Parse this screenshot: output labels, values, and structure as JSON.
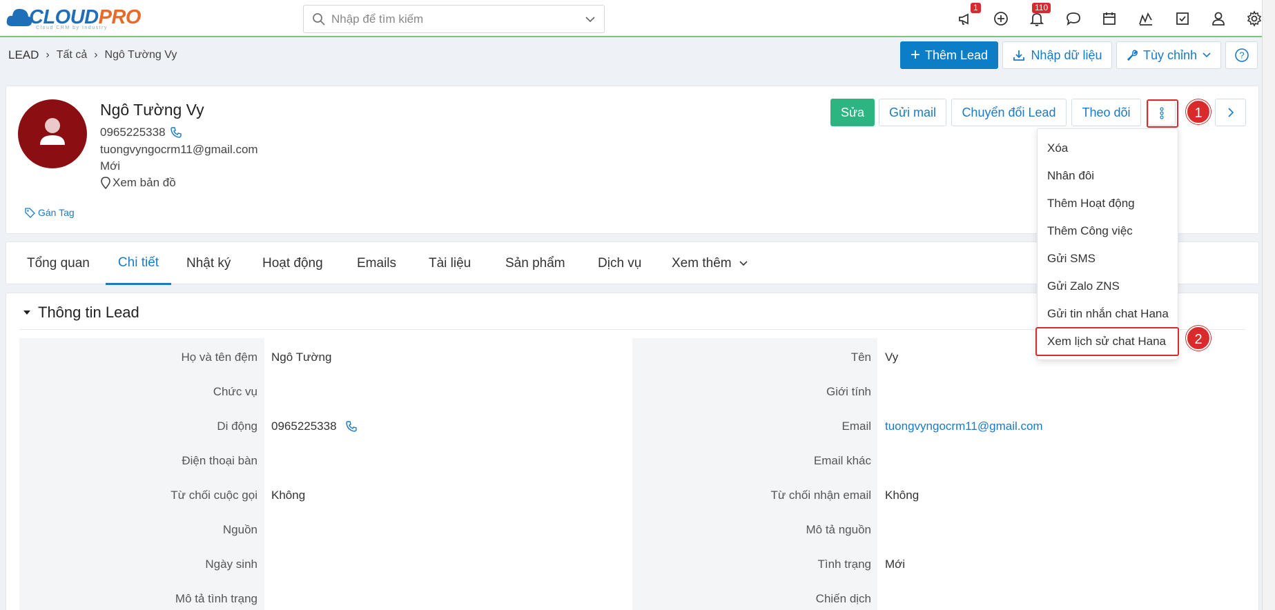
{
  "brand": {
    "name_a": "CLOUD",
    "name_b": "PRO",
    "tagline": "Cloud CRM by Industry"
  },
  "search": {
    "placeholder": "Nhập để tìm kiếm"
  },
  "badges": {
    "announce": "1",
    "notifications": "110"
  },
  "breadcrumb": {
    "root": "LEAD",
    "all": "Tất cả",
    "current": "Ngô Tường Vy"
  },
  "header_actions": {
    "add_lead": "Thêm Lead",
    "import": "Nhập dữ liệu",
    "customize": "Tùy chỉnh"
  },
  "profile": {
    "name": "Ngô Tường Vy",
    "phone": "0965225338",
    "email": "tuongvyngocrm11@gmail.com",
    "status": "Mới",
    "map": "Xem bản đồ",
    "tag": "Gán Tag"
  },
  "profile_actions": {
    "edit": "Sửa",
    "send_mail": "Gửi mail",
    "convert": "Chuyển đổi Lead",
    "follow": "Theo dõi"
  },
  "tabs": [
    "Tổng quan",
    "Chi tiết",
    "Nhật ký",
    "Hoạt động",
    "Emails",
    "Tài liệu",
    "Sản phẩm",
    "Dịch vụ",
    "Xem thêm"
  ],
  "section": {
    "title": "Thông tin Lead"
  },
  "fields_left": [
    {
      "label": "Họ và tên đệm",
      "value": "Ngô Tường"
    },
    {
      "label": "Chức vụ",
      "value": ""
    },
    {
      "label": "Di động",
      "value": "0965225338"
    },
    {
      "label": "Điện thoại bàn",
      "value": ""
    },
    {
      "label": "Từ chối cuộc gọi",
      "value": "Không"
    },
    {
      "label": "Nguồn",
      "value": ""
    },
    {
      "label": "Ngày sinh",
      "value": ""
    },
    {
      "label": "Mô tả tình trạng",
      "value": ""
    }
  ],
  "fields_right": [
    {
      "label": "Tên",
      "value": "Vy"
    },
    {
      "label": "Giới tính",
      "value": ""
    },
    {
      "label": "Email",
      "value": "tuongvyngocrm11@gmail.com"
    },
    {
      "label": "Email khác",
      "value": ""
    },
    {
      "label": "Từ chối nhận email",
      "value": "Không"
    },
    {
      "label": "Mô tả nguồn",
      "value": ""
    },
    {
      "label": "Tình trạng",
      "value": "Mới"
    },
    {
      "label": "Chiến dịch",
      "value": ""
    }
  ],
  "dropdown": [
    "Xóa",
    "Nhân đôi",
    "Thêm Hoạt động",
    "Thêm Công việc",
    "Gửi SMS",
    "Gửi Zalo ZNS",
    "Gửi tin nhắn chat Hana",
    "Xem lịch sử chat Hana"
  ],
  "annotations": {
    "step1": "1",
    "step2": "2"
  },
  "colors": {
    "primary": "#0b7ec7",
    "success": "#2cb580",
    "avatar": "#8b0f12",
    "highlight": "#d92b2b"
  }
}
